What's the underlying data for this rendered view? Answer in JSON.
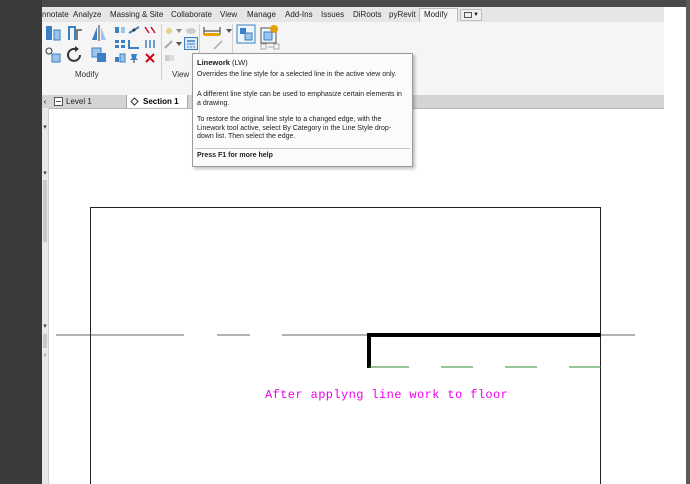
{
  "ribbon": {
    "tabs": [
      {
        "id": "annotate",
        "label": "nnotate"
      },
      {
        "id": "analyze",
        "label": "Analyze"
      },
      {
        "id": "massing",
        "label": "Massing & Site"
      },
      {
        "id": "collaborate",
        "label": "Collaborate"
      },
      {
        "id": "view",
        "label": "View"
      },
      {
        "id": "manage",
        "label": "Manage"
      },
      {
        "id": "addins",
        "label": "Add-Ins"
      },
      {
        "id": "issues",
        "label": "Issues"
      },
      {
        "id": "diroots",
        "label": "DiRoots"
      },
      {
        "id": "pyrevit",
        "label": "pyRevit"
      },
      {
        "id": "modify",
        "label": "Modify"
      }
    ],
    "active_tab": "Modify",
    "panels": {
      "modify_label": "Modify",
      "view_label": "View"
    }
  },
  "view_tabs": [
    {
      "id": "level1",
      "label": "Level 1",
      "active": false
    },
    {
      "id": "section1",
      "label": "Section 1",
      "active": true
    }
  ],
  "tooltip": {
    "title": "Linework",
    "shortcut": "(LW)",
    "line1": "Overrides the line style for a selected line in the active view only.",
    "para2": [
      "A different line style can be used to emphasize certain elements in",
      "a drawing."
    ],
    "para3": [
      "To restore the original line style to a changed edge, with the",
      "Linework tool active, select By Category in the Line Style drop-",
      "down list. Then select the edge."
    ],
    "help": "Press F1 for more help"
  },
  "canvas": {
    "annotation": "After applyng line work to floor",
    "annotation_color": "#ee00ee",
    "linework_color": "#000000",
    "dashed_edge_color": "#2e8b2e"
  },
  "icons": [
    "align-icon",
    "offset-icon",
    "mirror-pick-axis-icon",
    "mirror-draw-axis-icon",
    "split-icon",
    "trim-icon",
    "move-icon",
    "rotate-icon",
    "copy-icon",
    "array-icon",
    "scale-icon",
    "pin-icon",
    "delete-icon",
    "linework-icon",
    "dimension-icon",
    "create-group-icon",
    "create-assembly-icon"
  ]
}
